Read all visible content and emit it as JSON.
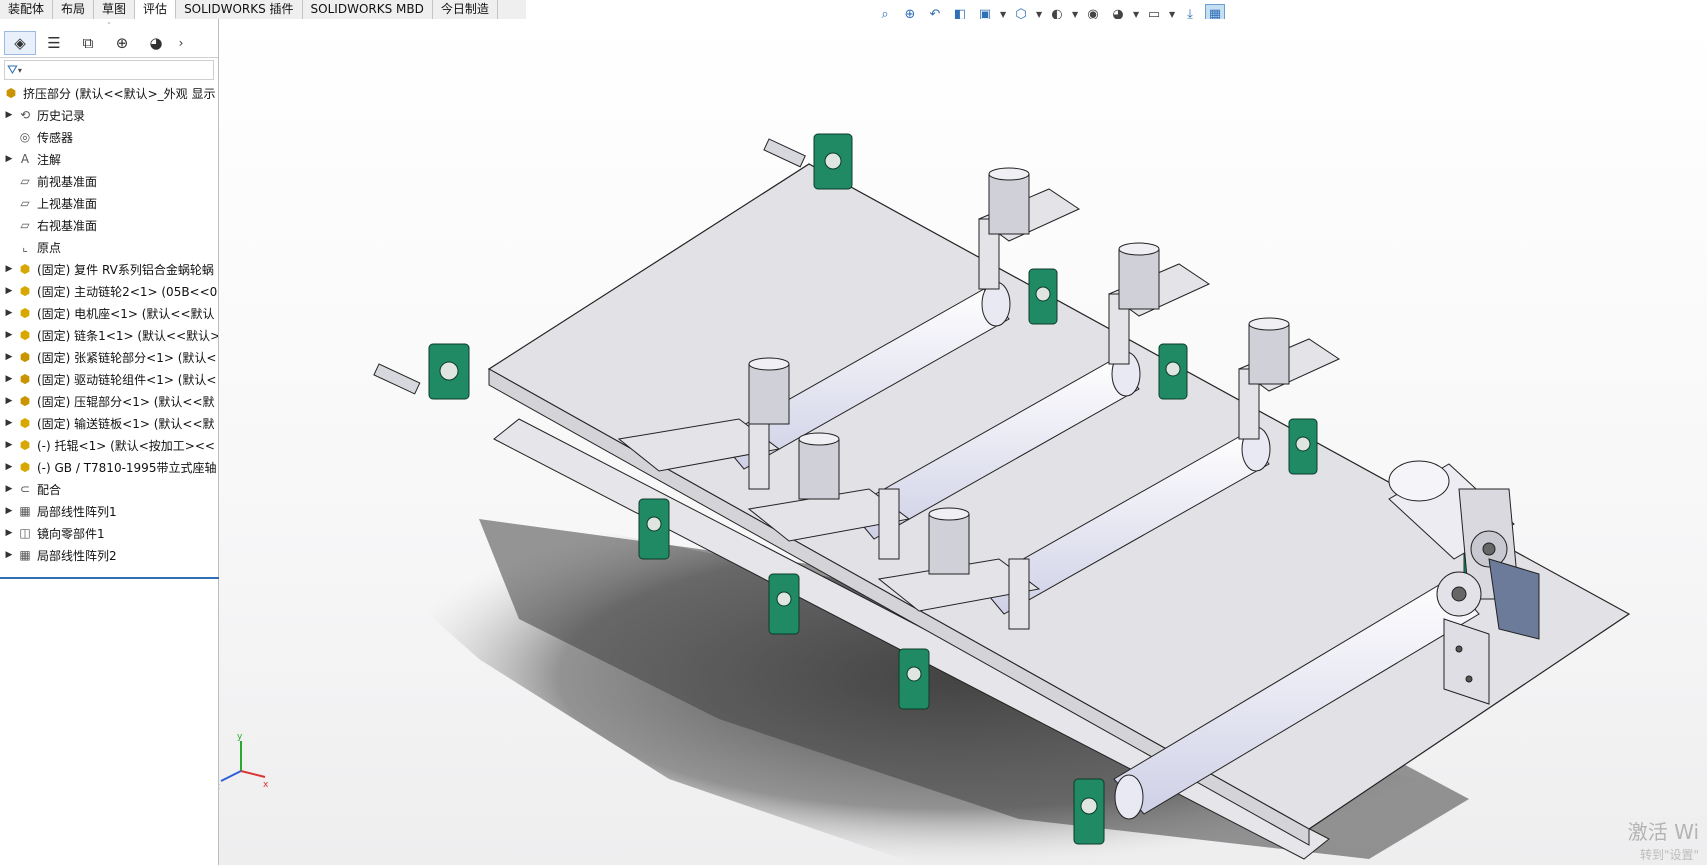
{
  "command_tabs": [
    "装配体",
    "布局",
    "草图",
    "评估",
    "SOLIDWORKS 插件",
    "SOLIDWORKS MBD",
    "今日制造"
  ],
  "active_tab": "评估",
  "view_toolbar_icons": [
    "zoom-to-fit-icon",
    "zoom-area-icon",
    "previous-view-icon",
    "section-view-icon",
    "dynamic-annotation-icon",
    "view-orientation-icon",
    "display-style-icon",
    "hide-show-icon",
    "edit-appearance-icon",
    "apply-scene-icon",
    "view-settings-icon",
    "rotate-icon",
    "view-cube-icon"
  ],
  "panel_tabs": [
    "feature-manager-icon",
    "property-manager-icon",
    "configuration-manager-icon",
    "dimxpert-icon",
    "display-manager-icon"
  ],
  "tree": {
    "root_label": "挤压部分  (默认<<默认>_外观 显示",
    "items": [
      {
        "label": "历史记录",
        "icon": "history-icon",
        "expandable": true
      },
      {
        "label": "传感器",
        "icon": "sensor-icon",
        "expandable": false
      },
      {
        "label": "注解",
        "icon": "annotation-icon",
        "expandable": true
      },
      {
        "label": "前视基准面",
        "icon": "plane-icon",
        "expandable": false
      },
      {
        "label": "上视基准面",
        "icon": "plane-icon",
        "expandable": false
      },
      {
        "label": "右视基准面",
        "icon": "plane-icon",
        "expandable": false
      },
      {
        "label": "原点",
        "icon": "origin-icon",
        "expandable": false
      },
      {
        "label": "(固定) 复件 RV系列铝合金蜗轮蜗",
        "icon": "part-icon",
        "expandable": true
      },
      {
        "label": "(固定) 主动链轮2<1> (05B<<0",
        "icon": "part-icon",
        "expandable": true
      },
      {
        "label": "(固定) 电机座<1> (默认<<默认",
        "icon": "part-icon",
        "expandable": true
      },
      {
        "label": "(固定) 链条1<1> (默认<<默认>",
        "icon": "part-icon",
        "expandable": true
      },
      {
        "label": "(固定) 张紧链轮部分<1> (默认<",
        "icon": "assembly-icon",
        "expandable": true
      },
      {
        "label": "(固定) 驱动链轮组件<1> (默认<",
        "icon": "assembly-icon",
        "expandable": true
      },
      {
        "label": "(固定) 压辊部分<1> (默认<<默",
        "icon": "assembly-icon",
        "expandable": true
      },
      {
        "label": "(固定) 输送链板<1> (默认<<默",
        "icon": "part-icon",
        "expandable": true
      },
      {
        "label": "(-) 托辊<1> (默认<按加工><<",
        "icon": "part-icon",
        "expandable": true
      },
      {
        "label": "(-) GB / T7810-1995带立式座轴",
        "icon": "part-icon",
        "expandable": true
      },
      {
        "label": "配合",
        "icon": "mates-icon",
        "expandable": true
      },
      {
        "label": "局部线性阵列1",
        "icon": "pattern-icon",
        "expandable": true
      },
      {
        "label": "镜向零部件1",
        "icon": "mirror-icon",
        "expandable": true
      },
      {
        "label": "局部线性阵列2",
        "icon": "pattern-icon",
        "expandable": true
      }
    ]
  },
  "triad": {
    "x": "x",
    "y": "y",
    "z": "z"
  },
  "watermark": {
    "line1": "激活 Wi",
    "line2": "转到\"设置\""
  },
  "colors": {
    "belt": "#e2e2e6",
    "bearing": "#1f8a63",
    "roller": "#eeeef8",
    "edge": "#222222"
  }
}
